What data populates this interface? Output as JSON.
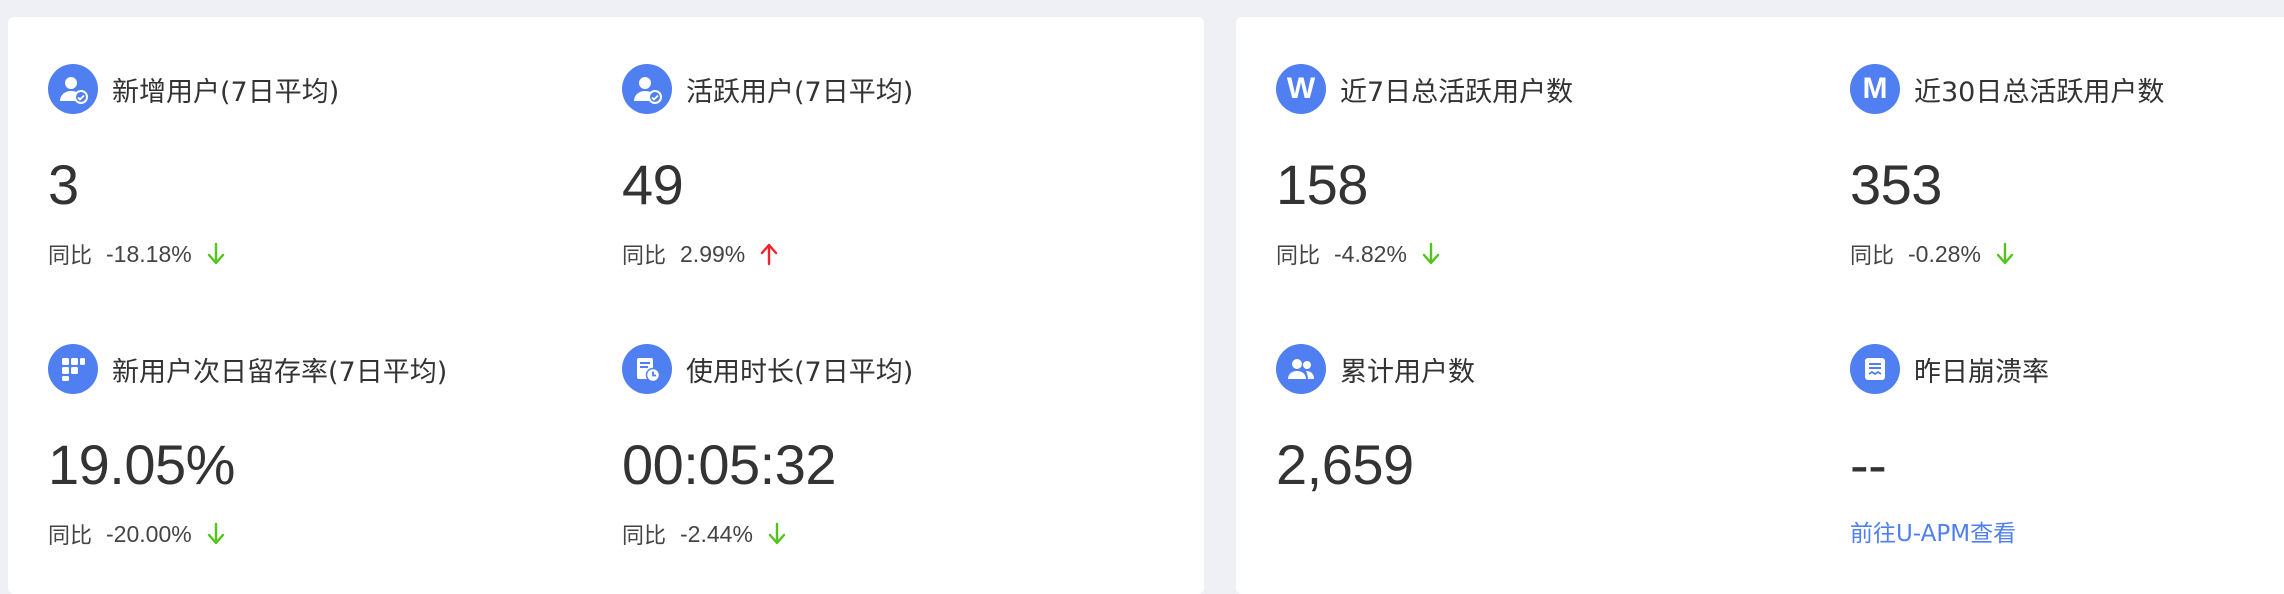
{
  "colors": {
    "accent": "#4f7ff1",
    "down": "#52c41a",
    "up": "#f5222d",
    "page_bg": "#eef0f5",
    "card_bg": "#ffffff"
  },
  "overview": {
    "new_users": {
      "icon": "user-icon",
      "title": "新增用户(7日平均)",
      "value": "3",
      "change_label": "同比",
      "change_value": "-18.18%",
      "trend": "down"
    },
    "active_users": {
      "icon": "user-check-icon",
      "title": "活跃用户(7日平均)",
      "value": "49",
      "change_label": "同比",
      "change_value": "2.99%",
      "trend": "up"
    },
    "retention": {
      "icon": "grid-icon",
      "title": "新用户次日留存率(7日平均)",
      "value": "19.05%",
      "change_label": "同比",
      "change_value": "-20.00%",
      "trend": "down"
    },
    "usage_time": {
      "icon": "clock-document-icon",
      "title": "使用时长(7日平均)",
      "value": "00:05:32",
      "change_label": "同比",
      "change_value": "-2.44%",
      "trend": "down"
    }
  },
  "totals": {
    "weekly_active": {
      "icon": "letter-w-icon",
      "badge": "W",
      "title": "近7日总活跃用户数",
      "value": "158",
      "change_label": "同比",
      "change_value": "-4.82%",
      "trend": "down"
    },
    "monthly_active": {
      "icon": "letter-m-icon",
      "badge": "M",
      "title": "近30日总活跃用户数",
      "value": "353",
      "change_label": "同比",
      "change_value": "-0.28%",
      "trend": "down"
    },
    "total_users": {
      "icon": "users-icon",
      "title": "累计用户数",
      "value": "2,659"
    },
    "crash_rate": {
      "icon": "report-icon",
      "title": "昨日崩溃率",
      "value": "--",
      "link_label": "前往U-APM查看"
    }
  }
}
